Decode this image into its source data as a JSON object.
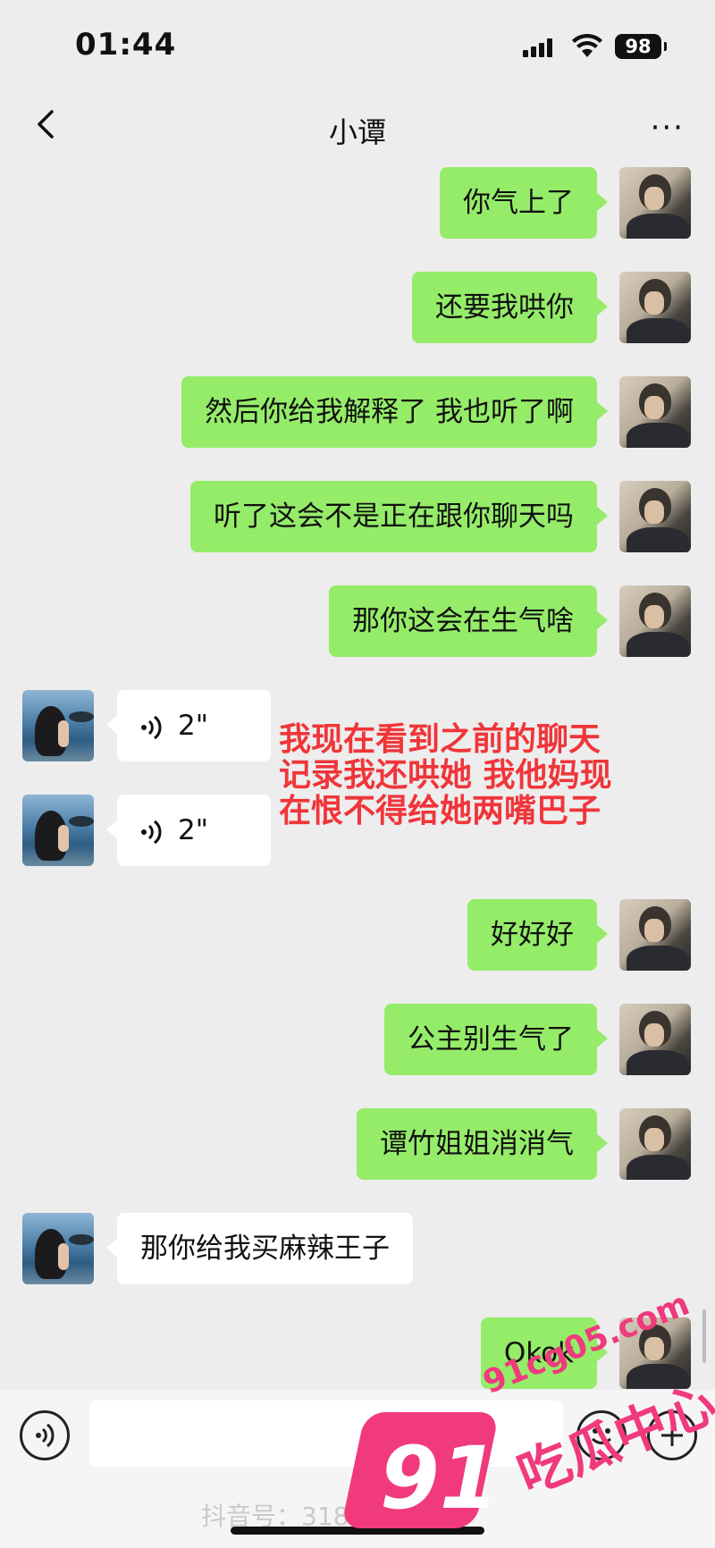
{
  "status": {
    "time": "01:44",
    "battery": "98"
  },
  "nav": {
    "title": "小谭",
    "more": "···"
  },
  "messages": {
    "m1": "你气上了",
    "m2": "还要我哄你",
    "m3": "然后你给我解释了 我也听了啊",
    "m4": "听了这会不是正在跟你聊天吗",
    "m5": "那你这会在生气啥",
    "v1": "2\"",
    "v2": "2\"",
    "m6": "好好好",
    "m7": "公主别生气了",
    "m8": "谭竹姐姐消消气",
    "m9": "那你给我买麻辣王子",
    "m10": "Okok"
  },
  "overlay": {
    "line1": "我现在看到之前的聊天",
    "line2": "记录我还哄她 我他妈现",
    "line3": "在恨不得给她两嘴巴子"
  },
  "watermark": {
    "num": "91",
    "url": "91cg05.com",
    "cn": "吃瓜中心"
  },
  "footer": {
    "douyin": "抖音号：3180···787"
  },
  "icons": [
    "back-icon",
    "more-icon",
    "voice-icon",
    "emoji-icon",
    "plus-icon",
    "signal-icon",
    "wifi-icon",
    "battery-icon"
  ]
}
